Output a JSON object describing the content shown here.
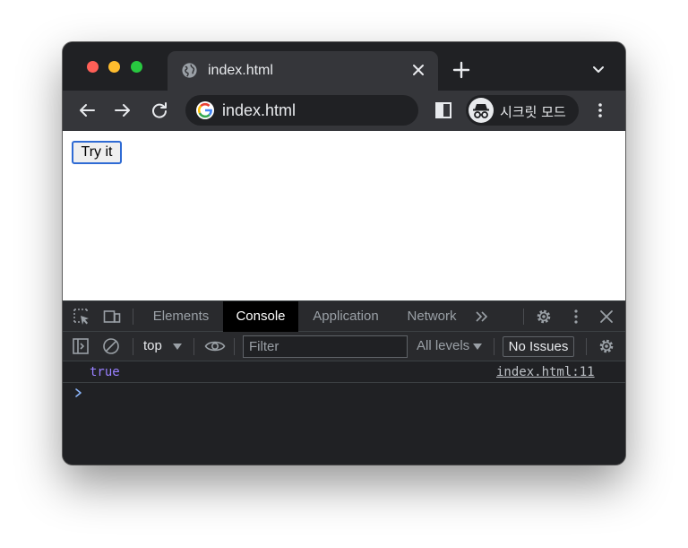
{
  "browser": {
    "tab": {
      "title": "index.html"
    },
    "omnibox": {
      "url": "index.html"
    },
    "incognito": {
      "label": "시크릿 모드"
    },
    "colors": {
      "close": "#ff5f57",
      "minimize": "#febc2e",
      "zoom": "#28c840",
      "focus_ring": "#2f6bd4"
    }
  },
  "page": {
    "button": {
      "label": "Try it"
    }
  },
  "devtools": {
    "tabs": [
      {
        "label": "Elements"
      },
      {
        "label": "Console"
      },
      {
        "label": "Application"
      },
      {
        "label": "Network"
      }
    ],
    "active_tab": "Console",
    "console": {
      "context": "top",
      "filter_placeholder": "Filter",
      "levels": "All levels",
      "issues": "No Issues",
      "log": {
        "value": "true",
        "source": "index.html:11"
      },
      "value_color": "#9980ff"
    }
  }
}
